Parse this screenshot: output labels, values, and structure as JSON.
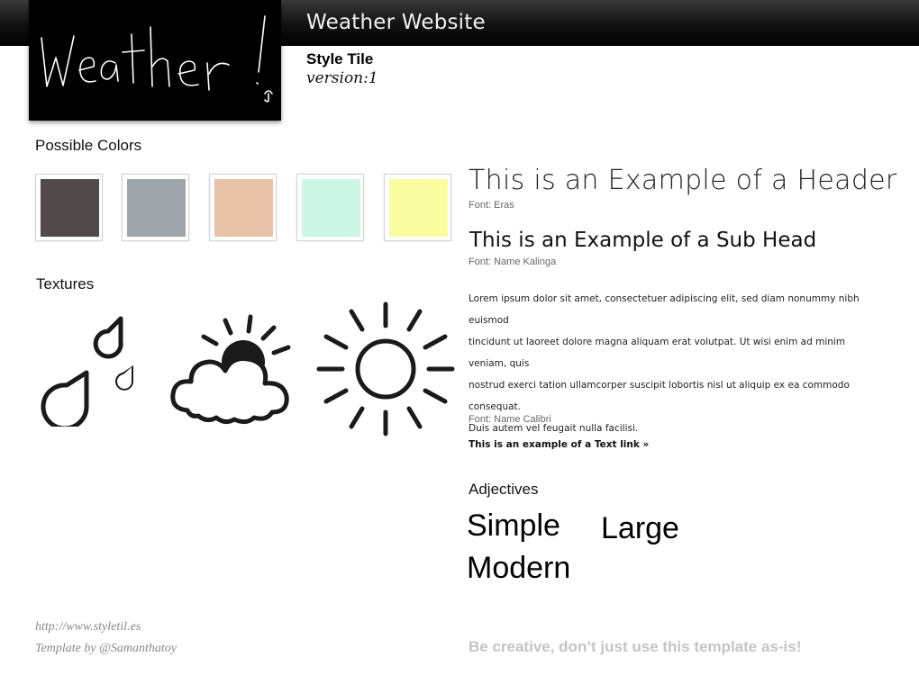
{
  "header": {
    "site_title": "Weather Website"
  },
  "logo": {
    "text": "weather!"
  },
  "tile": {
    "title": "Style Tile",
    "version": "version:1"
  },
  "colors": {
    "label": "Possible Colors",
    "swatches": [
      "#504b4a",
      "#9ea6aa",
      "#e8c3a7",
      "#cdf6e4",
      "#fafca0"
    ]
  },
  "textures": {
    "label": "Textures",
    "icons": [
      "raindrops-icon",
      "partly-sunny-cloud-icon",
      "sun-icon"
    ]
  },
  "typography": {
    "header_example": "This is an Example of a Header",
    "header_font": "Font: Eras",
    "subhead_example": "This is an Example of a Sub Head",
    "subhead_font": "Font:  Name  Kalinga",
    "body_lines": [
      "Lorem ipsum dolor sit amet, consectetuer adipiscing elit, sed diam nonummy nibh euismod",
      "tincidunt ut laoreet dolore magna aliquam erat volutpat. Ut wisi enim ad minim veniam, quis",
      "nostrud exerci tation ullamcorper suscipit lobortis nisl ut aliquip ex ea commodo consequat.",
      "Duis autem vel feugait nulla facilisi."
    ],
    "body_font": "Font: Name Calibri",
    "text_link": "This is an example of a Text link »"
  },
  "adjectives": {
    "label": "Adjectives",
    "words": [
      "Simple",
      "Large",
      "Modern"
    ]
  },
  "footer": {
    "url": "http://www.styletil.es",
    "credit": "Template by @Samanthatoy",
    "tagline": "Be creative, don’t just use this template as-is!"
  }
}
